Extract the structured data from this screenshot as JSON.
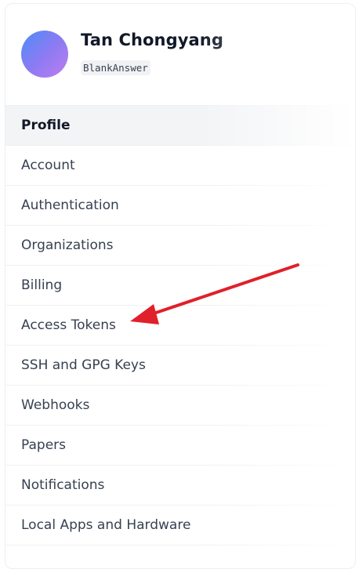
{
  "user": {
    "name": "Tan Chongyang",
    "handle": "BlankAnswer"
  },
  "menu": {
    "items": [
      {
        "label": "Profile",
        "active": true
      },
      {
        "label": "Account"
      },
      {
        "label": "Authentication"
      },
      {
        "label": "Organizations"
      },
      {
        "label": "Billing"
      },
      {
        "label": "Access Tokens"
      },
      {
        "label": "SSH and GPG Keys"
      },
      {
        "label": "Webhooks"
      },
      {
        "label": "Papers"
      },
      {
        "label": "Notifications"
      },
      {
        "label": "Local Apps and Hardware"
      }
    ]
  },
  "colors": {
    "annotation_arrow": "#e0202a"
  }
}
